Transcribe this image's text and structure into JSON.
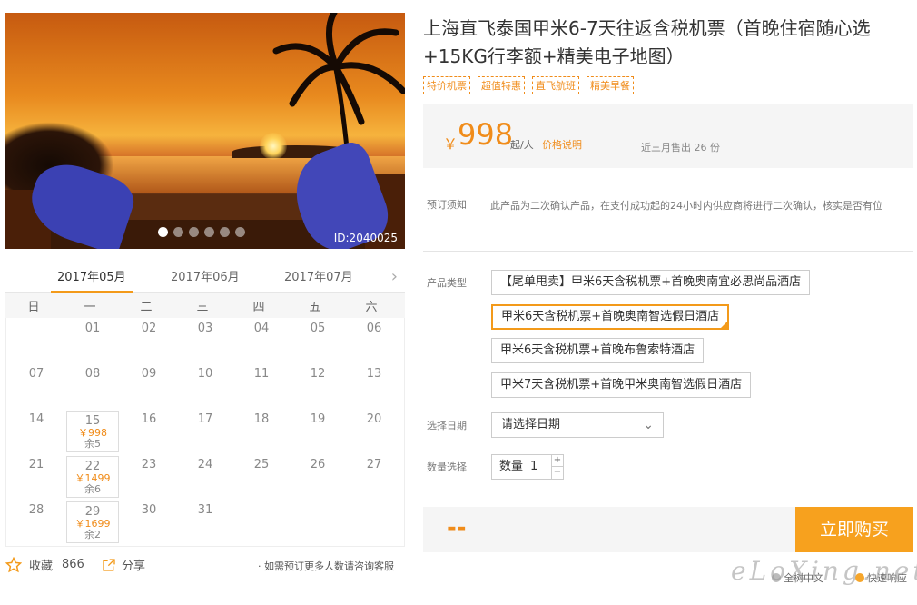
{
  "hero": {
    "image_id": "ID:2040025",
    "dots": 6,
    "active_dot": 0
  },
  "calendar": {
    "months": [
      "2017年05月",
      "2017年06月",
      "2017年07月"
    ],
    "active_month": 0,
    "weekdays": [
      "日",
      "一",
      "二",
      "三",
      "四",
      "五",
      "六"
    ],
    "weeks": [
      [
        {
          "d": ""
        },
        {
          "d": "01"
        },
        {
          "d": "02"
        },
        {
          "d": "03"
        },
        {
          "d": "04"
        },
        {
          "d": "05"
        },
        {
          "d": "06"
        }
      ],
      [
        {
          "d": "07"
        },
        {
          "d": "08"
        },
        {
          "d": "09"
        },
        {
          "d": "10"
        },
        {
          "d": "11"
        },
        {
          "d": "12"
        },
        {
          "d": "13"
        }
      ],
      [
        {
          "d": "14"
        },
        {
          "d": "15",
          "price": "￥998",
          "stock": "余5"
        },
        {
          "d": "16"
        },
        {
          "d": "17"
        },
        {
          "d": "18"
        },
        {
          "d": "19"
        },
        {
          "d": "20"
        }
      ],
      [
        {
          "d": "21"
        },
        {
          "d": "22",
          "price": "￥1499",
          "stock": "余6"
        },
        {
          "d": "23"
        },
        {
          "d": "24"
        },
        {
          "d": "25"
        },
        {
          "d": "26"
        },
        {
          "d": "27"
        }
      ],
      [
        {
          "d": "28"
        },
        {
          "d": "29",
          "price": "￥1699",
          "stock": "余2"
        },
        {
          "d": "30"
        },
        {
          "d": "31"
        },
        {
          "d": ""
        },
        {
          "d": ""
        },
        {
          "d": ""
        }
      ]
    ]
  },
  "footer_left": {
    "favorite_label": "收藏",
    "favorite_count": "866",
    "share_label": "分享",
    "ask_text": "· 如需预订更多人数请咨询客服"
  },
  "product": {
    "title": "上海直飞泰国甲米6-7天往返含税机票（首晚住宿随心选+15KG行李额+精美电子地图）",
    "tags": [
      "特价机票",
      "超值特惠",
      "直飞航班",
      "精美早餐"
    ]
  },
  "price": {
    "currency": "￥",
    "amount": "998",
    "unit": "起/人",
    "price_link": "价格说明",
    "sold": "近三月售出 26 份"
  },
  "booking": {
    "notice_label": "预订须知",
    "notice_text": "此产品为二次确认产品，在支付成功起的24小时内供应商将进行二次确认，核实是否有位",
    "type_label": "产品类型",
    "options": [
      "【尾单甩卖】甲米6天含税机票+首晚奥南宜必思尚品酒店",
      "甲米6天含税机票+首晚奥南智选假日酒店",
      "甲米6天含税机票+首晚布鲁索特酒店",
      "甲米7天含税机票+首晚甲米奥南智选假日酒店"
    ],
    "selected_option": 1,
    "date_label": "选择日期",
    "date_placeholder": "请选择日期",
    "qty_label": "数量选择",
    "qty_prefix": "数量",
    "qty_value": "1"
  },
  "buy": {
    "total": "--",
    "button": "立即购买"
  },
  "promises": [
    "全树中文",
    "快速响应"
  ],
  "watermark": "eLoXing.net"
}
